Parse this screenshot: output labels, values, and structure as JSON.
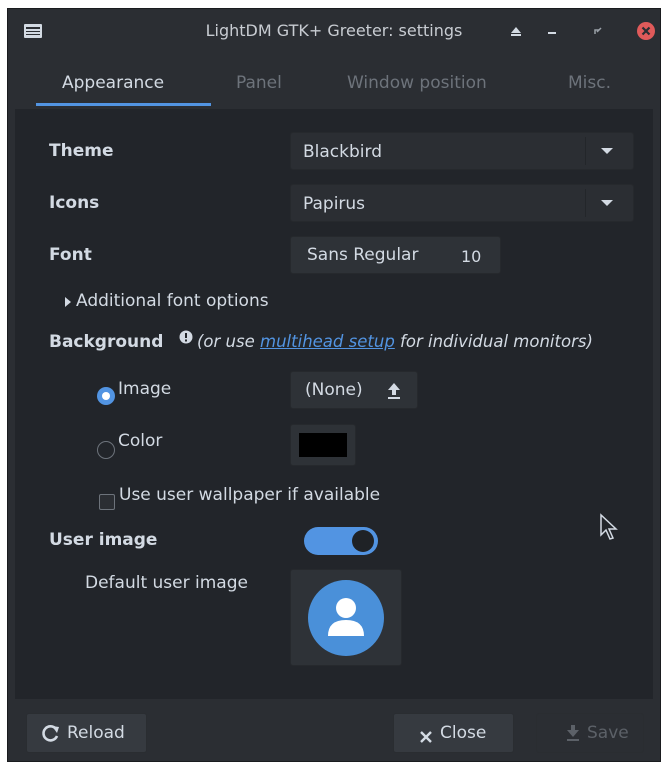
{
  "window": {
    "title": "LightDM GTK+ Greeter: settings"
  },
  "titlebar_icons": [
    "app-menu-icon",
    "keep-above-icon",
    "minimize-icon",
    "restore-icon",
    "close-icon"
  ],
  "tabs": [
    {
      "label": "Appearance",
      "active": true
    },
    {
      "label": "Panel",
      "active": false
    },
    {
      "label": "Window position",
      "active": false
    },
    {
      "label": "Misc.",
      "active": false
    }
  ],
  "appearance": {
    "theme_label": "Theme",
    "theme_value": "Blackbird",
    "icons_label": "Icons",
    "icons_value": "Papirus",
    "font_label": "Font",
    "font_name": "Sans Regular",
    "font_size": "10",
    "additional_font_options": "Additional font options",
    "background_label": "Background",
    "background_note_pre": "(or use",
    "background_note_link": "multihead setup",
    "background_note_post": "for individual monitors)",
    "image_option": "Image",
    "image_button": "(None)",
    "color_option": "Color",
    "color_value": "#000000",
    "use_wallpaper_label": "Use user wallpaper if available",
    "user_image_label": "User image",
    "user_image_enabled": true,
    "default_user_image_label": "Default user image"
  },
  "footer": {
    "reload": "Reload",
    "close": "Close",
    "save": "Save"
  },
  "colors": {
    "accent": "#5294e2",
    "close_button": "#e05a5a",
    "window_bg": "#2b2e33",
    "panel_bg": "#22252a"
  }
}
